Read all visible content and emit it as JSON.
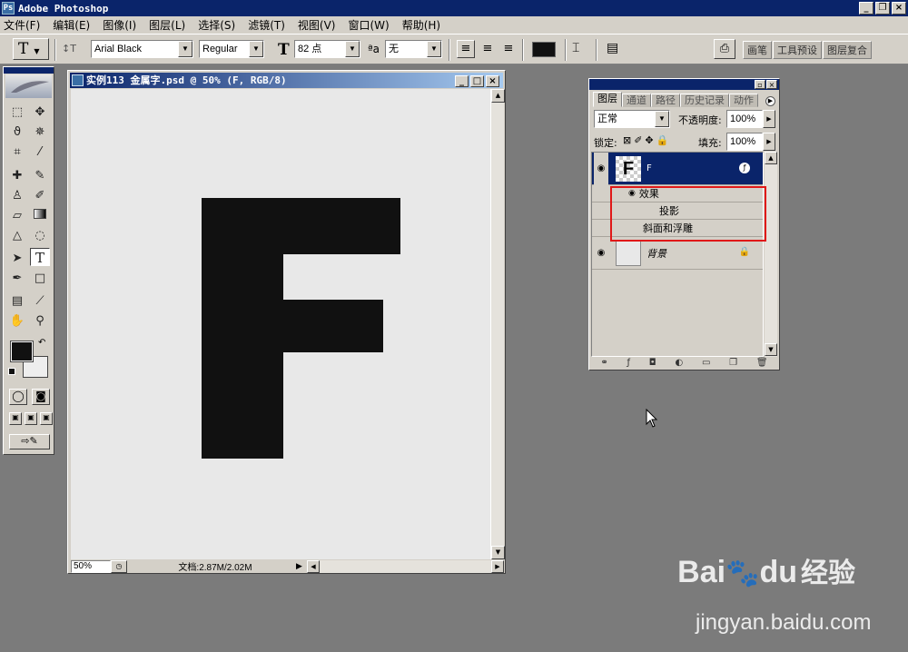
{
  "app": {
    "title": "Adobe Photoshop",
    "icon_label": "Ps"
  },
  "window_buttons": {
    "minimize": "_",
    "restore": "❐",
    "close": "×"
  },
  "menu": [
    "文件(F)",
    "编辑(E)",
    "图像(I)",
    "图层(L)",
    "选择(S)",
    "滤镜(T)",
    "视图(V)",
    "窗口(W)",
    "帮助(H)"
  ],
  "options": {
    "tool_glyph": "T",
    "orient_glyph": "↕T",
    "font_family": "Arial Black",
    "font_style": "Regular",
    "size_glyph": "T",
    "font_size": "82 点",
    "aa_glyph": "ªa",
    "antialias": "无",
    "align_left": "≡",
    "align_center": "≡",
    "align_right": "≡",
    "color": "#111111",
    "warp_glyph": "⌶",
    "palette_glyph": "▤",
    "tabs": [
      "画笔",
      "工具预设",
      "图层复合"
    ]
  },
  "document": {
    "title": "实例113 金属字.psd @ 50% (F, RGB/8)",
    "letter": "F",
    "letter_color": "#111111",
    "canvas_color": "#e8e8e8",
    "zoom": "50%",
    "doc_info": "文档:2.87M/2.02M"
  },
  "layers_panel": {
    "tabs": [
      "图层",
      "通道",
      "路径",
      "历史记录",
      "动作"
    ],
    "blend_mode": "正常",
    "opacity_label": "不透明度:",
    "opacity": "100%",
    "lock_label": "锁定:",
    "fill_label": "填充:",
    "fill": "100%",
    "layers": [
      {
        "name": "F",
        "selected": true
      },
      {
        "name": "背景",
        "selected": false
      }
    ],
    "effects_label": "效果",
    "effects": [
      "投影",
      "斜面和浮雕"
    ]
  },
  "watermark": {
    "brand": "Bai",
    "brand_mid": "du",
    "brand_cn": "经验",
    "url": "jingyan.baidu.com"
  },
  "icons": [
    "eye-icon",
    "lock-icon",
    "feather-icon",
    "cursor-icon",
    "link-icon",
    "trash-icon"
  ]
}
